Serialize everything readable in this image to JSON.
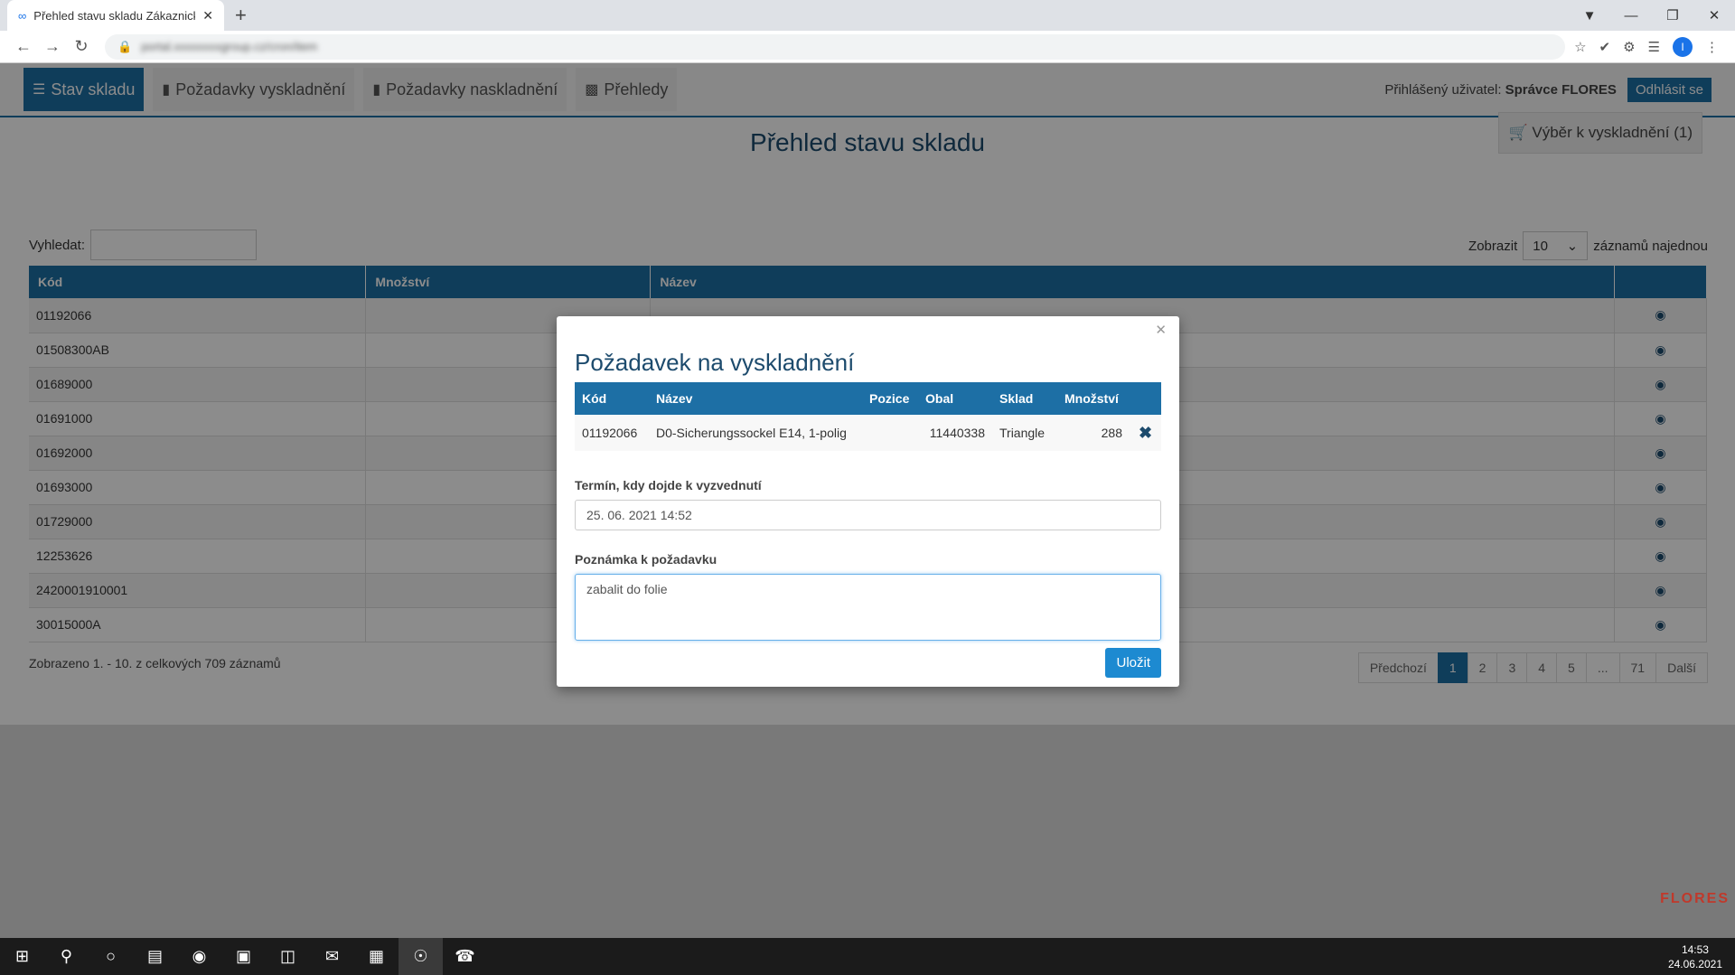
{
  "browser": {
    "tab_title": "Přehled stavu skladu Zákaznický",
    "url": "portal.xxxxxxxxgroup.cz/cron/item"
  },
  "nav": {
    "items": [
      {
        "label": "Stav skladu",
        "icon": "list-icon"
      },
      {
        "label": "Požadavky vyskladnění",
        "icon": "dolly-icon"
      },
      {
        "label": "Požadavky naskladnění",
        "icon": "dolly-icon"
      },
      {
        "label": "Přehledy",
        "icon": "bar-chart-icon"
      }
    ],
    "user_label": "Přihlášený uživatel:",
    "user_name": "Správce FLORES",
    "logout_label": "Odhlásit se"
  },
  "page": {
    "title": "Přehled stavu skladu",
    "cart_label": "Výběr k vyskladnění (1)",
    "search_label": "Vyhledat:",
    "show_label": "Zobrazit",
    "show_value": "10",
    "show_suffix": "záznamů najednou",
    "columns": [
      "Kód",
      "Množství",
      "Název"
    ],
    "rows": [
      "01192066",
      "01508300AB",
      "01689000",
      "01691000",
      "01692000",
      "01693000",
      "01729000",
      "12253626",
      "2420001910001",
      "30015000A"
    ],
    "info": "Zobrazeno 1. - 10. z celkových 709 záznamů",
    "pager": [
      "Předchozí",
      "1",
      "2",
      "3",
      "4",
      "5",
      "...",
      "71",
      "Další"
    ],
    "brand": "FLORES"
  },
  "modal": {
    "title": "Požadavek na vyskladnění",
    "columns": [
      "Kód",
      "Název",
      "Pozice",
      "Obal",
      "Sklad",
      "Množství"
    ],
    "item": {
      "code": "01192066",
      "name": "D0-Sicherungssockel E14, 1-polig",
      "pos": "",
      "pack": "11440338",
      "store": "Triangle",
      "qty": "288"
    },
    "date_label": "Termín, kdy dojde k vyzvednutí",
    "date_value": "25. 06. 2021 14:52",
    "note_label": "Poznámka k požadavku",
    "note_value": "zabalit do folie",
    "save_label": "Uložit"
  },
  "taskbar": {
    "time": "14:53",
    "date": "24.06.2021"
  }
}
